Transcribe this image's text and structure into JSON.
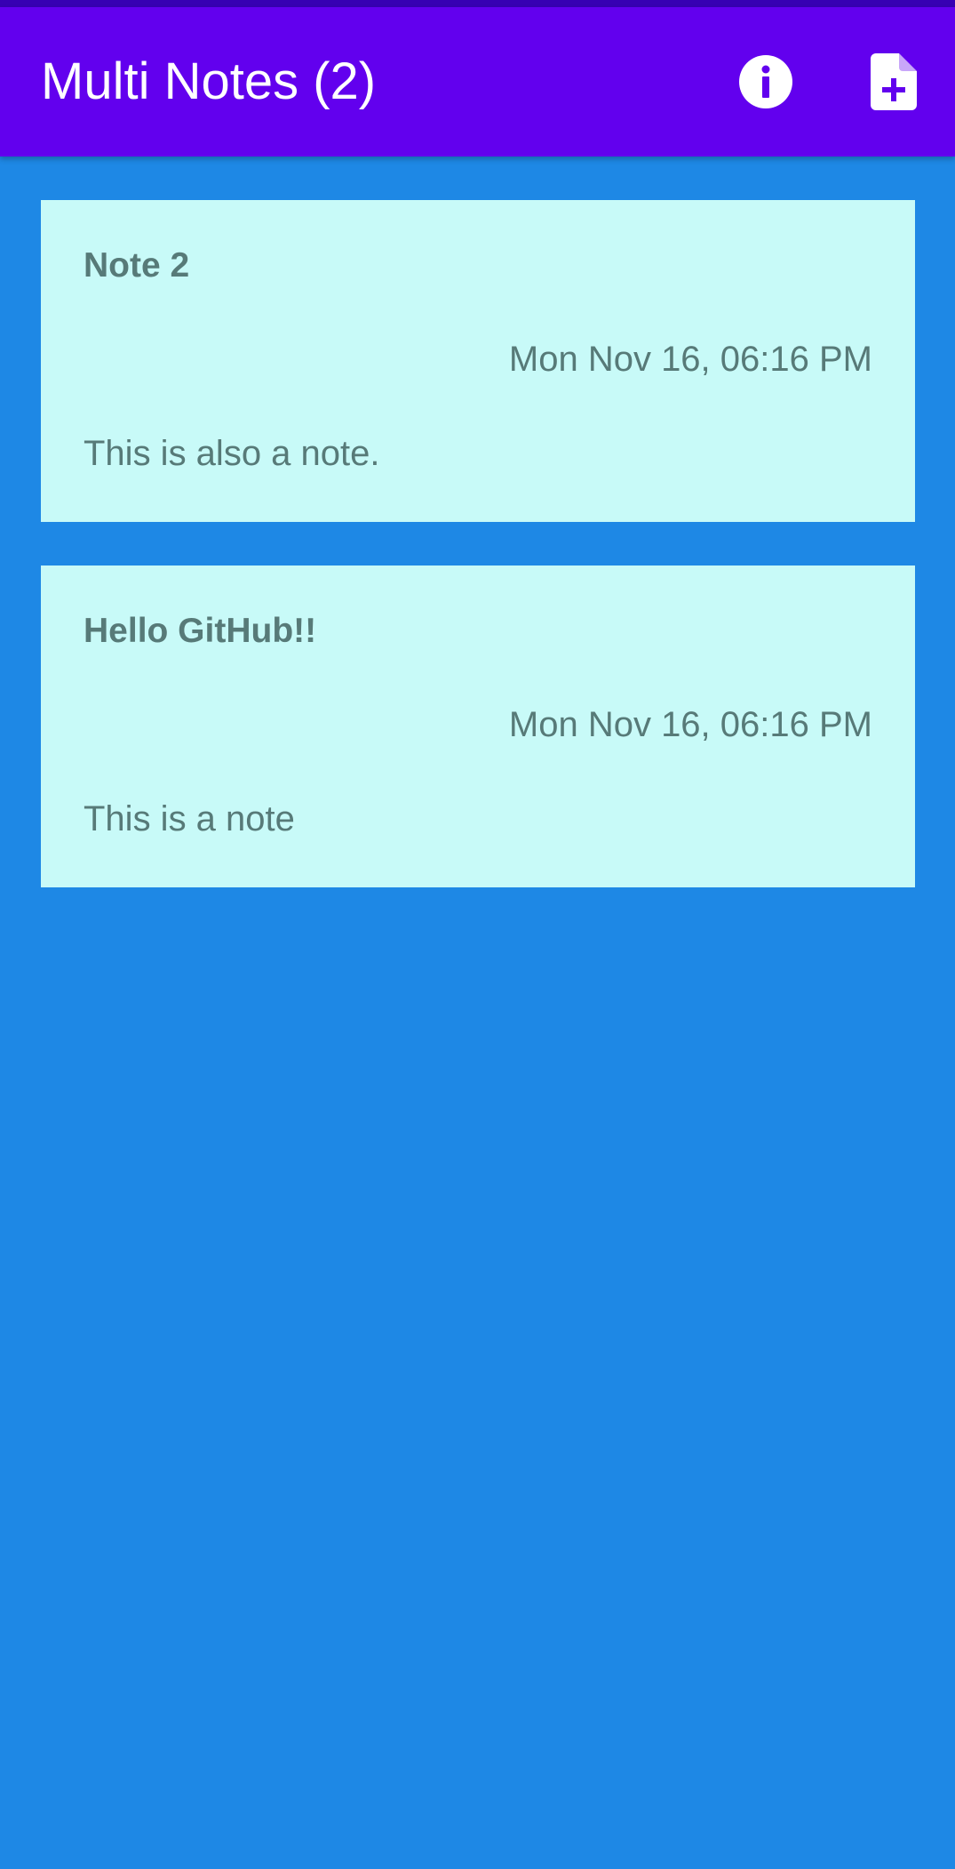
{
  "app_bar": {
    "title": "Multi Notes (2)",
    "actions": [
      {
        "name": "info",
        "icon": "info-icon"
      },
      {
        "name": "new-note",
        "icon": "note-add-icon"
      }
    ]
  },
  "notes": [
    {
      "title": "Note 2",
      "date": "Mon Nov 16, 06:16 PM",
      "body": "This is also a note."
    },
    {
      "title": "Hello GitHub!!",
      "date": "Mon Nov 16, 06:16 PM",
      "body": "This is a note"
    }
  ],
  "colors": {
    "status_bar": "#3700B3",
    "app_bar": "#6200EE",
    "background": "#1E88E5",
    "card": "#C8FAF8",
    "card_text": "#577A78"
  }
}
